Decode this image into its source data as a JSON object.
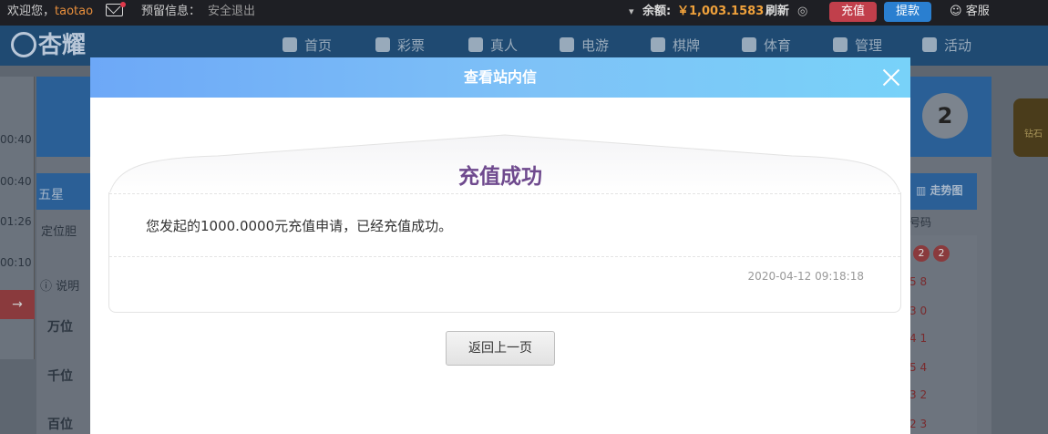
{
  "topbar": {
    "welcome": "欢迎您，",
    "username": "taotao",
    "reserved_info": "预留信息：",
    "logout": "安全退出",
    "balance_label": "余额:",
    "balance_value": "￥1,003.1583",
    "refresh": "刷新",
    "recharge": "充值",
    "withdraw": "提款",
    "service": "客服"
  },
  "brand": {
    "logo_text": "杏耀"
  },
  "nav": {
    "items": [
      {
        "label": "首页",
        "icon": "home-icon"
      },
      {
        "label": "彩票",
        "icon": "lottery-icon"
      },
      {
        "label": "真人",
        "icon": "live-icon"
      },
      {
        "label": "电游",
        "icon": "slot-icon"
      },
      {
        "label": "棋牌",
        "icon": "cards-icon"
      },
      {
        "label": "体育",
        "icon": "trophy-icon"
      },
      {
        "label": "管理",
        "icon": "users-icon"
      },
      {
        "label": "活动",
        "icon": "gift-icon"
      }
    ]
  },
  "background": {
    "left_times": [
      "00:40",
      "00:40",
      "01:26",
      "00:10"
    ],
    "tab_five_star": "五星",
    "locate_gall": "定位胆",
    "explain": "说明",
    "positions": [
      "万位",
      "千位",
      "百位"
    ],
    "trend": "走势图",
    "code_header": "号码",
    "issue_ball": "2",
    "red_balls": [
      "2",
      "2"
    ],
    "right_list": [
      "5 8",
      "3 0",
      "4 1",
      "5 4",
      "3 2",
      "2 3"
    ],
    "medal_text": "钻石"
  },
  "modal": {
    "title": "查看站内信",
    "message_title": "充值成功",
    "message_body": "您发起的1000.0000元充值申请，已经充值成功。",
    "message_time": "2020-04-12 09:18:18",
    "back_button": "返回上一页"
  },
  "colors": {
    "header_gradient_start": "#6da8f7",
    "header_gradient_end": "#78d2f9",
    "message_title": "#6f4a8e",
    "recharge_btn": "#c13f4b",
    "withdraw_btn": "#2a7fd0",
    "balance": "#f0a13b"
  }
}
